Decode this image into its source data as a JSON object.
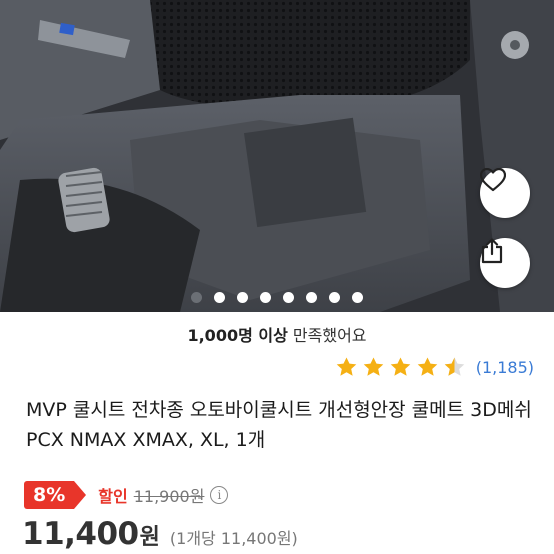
{
  "product_image": {
    "description_icon": "scooter-seat-photo",
    "slide_count": 8,
    "active_slide": 1
  },
  "actions": {
    "like_icon": "heart-icon",
    "share_icon": "share-icon"
  },
  "social_proof": {
    "count": "1,000명 이상",
    "suffix": "만족했어요"
  },
  "rating": {
    "value": 4.5,
    "count": "(1,185)",
    "star_color": "#f5b014"
  },
  "title": "MVP 쿨시트 전차종 오토바이쿨시트 개선형안장 쿨메트 3D메쉬 PCX NMAX XMAX, XL, 1개",
  "pricing": {
    "discount_pct": "8%",
    "discount_label": "할인",
    "original_price": "11,900원",
    "info_icon": "i",
    "price": "11,400",
    "currency": "원",
    "unit_price": "(1개당 11,400원)",
    "accent": "#e8352a"
  }
}
